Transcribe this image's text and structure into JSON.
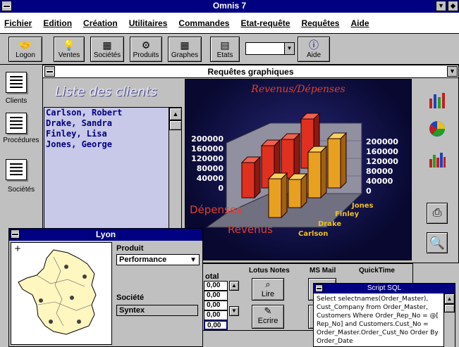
{
  "app": {
    "title": "Omnis 7"
  },
  "menu": [
    "Fichier",
    "Edition",
    "Création",
    "Utilitaires",
    "Commandes",
    "Etat-requête",
    "Requêtes",
    "Aide"
  ],
  "toolbar": {
    "buttons": [
      {
        "label": "Logon",
        "icon": "handshake-icon"
      },
      {
        "label": "Ventes",
        "icon": "bulb-icon"
      },
      {
        "label": "Sociétés",
        "icon": "building-icon"
      },
      {
        "label": "Produits",
        "icon": "products-icon"
      },
      {
        "label": "Graphes",
        "icon": "grid-icon"
      },
      {
        "label": "Etats",
        "icon": "report-icon"
      },
      {
        "label": "Aide",
        "icon": "info-icon"
      }
    ],
    "combo_value": ""
  },
  "left_icons": [
    {
      "label": "Clients"
    },
    {
      "label": "Procédures"
    },
    {
      "label": "Sociétés"
    }
  ],
  "requetes": {
    "title": "Requêtes graphiques",
    "list_title": "Liste des clients",
    "clients": [
      "Carlson, Robert",
      "Drake, Sandra",
      "Finley, Lisa",
      "Jones, George"
    ]
  },
  "chart_data": {
    "type": "bar",
    "title": "Revenus/Dépenses",
    "y_ticks_left": [
      "200000",
      "160000",
      "120000",
      "80000",
      "40000",
      "0"
    ],
    "y_ticks_right": [
      "200000",
      "160000",
      "120000",
      "80000",
      "40000",
      "0"
    ],
    "depth_labels": [
      "Dépenses",
      "Revenus"
    ],
    "categories": [
      "Carlson",
      "Drake",
      "Finley",
      "Jones"
    ],
    "series": [
      {
        "name": "Dépenses",
        "color": "#e03020",
        "values": [
          100000,
          120000,
          110000,
          140000
        ]
      },
      {
        "name": "Revenus",
        "color": "#e8a020",
        "values": [
          110000,
          80000,
          130000,
          140000
        ]
      }
    ],
    "ylim": [
      0,
      200000
    ]
  },
  "lyon": {
    "title": "Lyon",
    "produit_label": "Produit",
    "produit_value": "Performance",
    "societe_label": "Société",
    "societe_value": "Syntex"
  },
  "bottom_panel": {
    "col_header": "otal",
    "values": [
      "0,00",
      "0,00",
      "0,00",
      "0,00"
    ],
    "total": "0,00",
    "headers": [
      "Lotus Notes",
      "MS Mail",
      "QuickTime"
    ],
    "lire": "Lire",
    "ecrire": "Ecrire"
  },
  "sql": {
    "title": "Script SQL",
    "text": "Select selectnames(Order_Master), Cust_Company from Order_Master, Customers Where Order_Rep_No = @[ Rep_No] and Customers.Cust_No = Order_Master.Order_Cust_No Order By Order_Date"
  }
}
